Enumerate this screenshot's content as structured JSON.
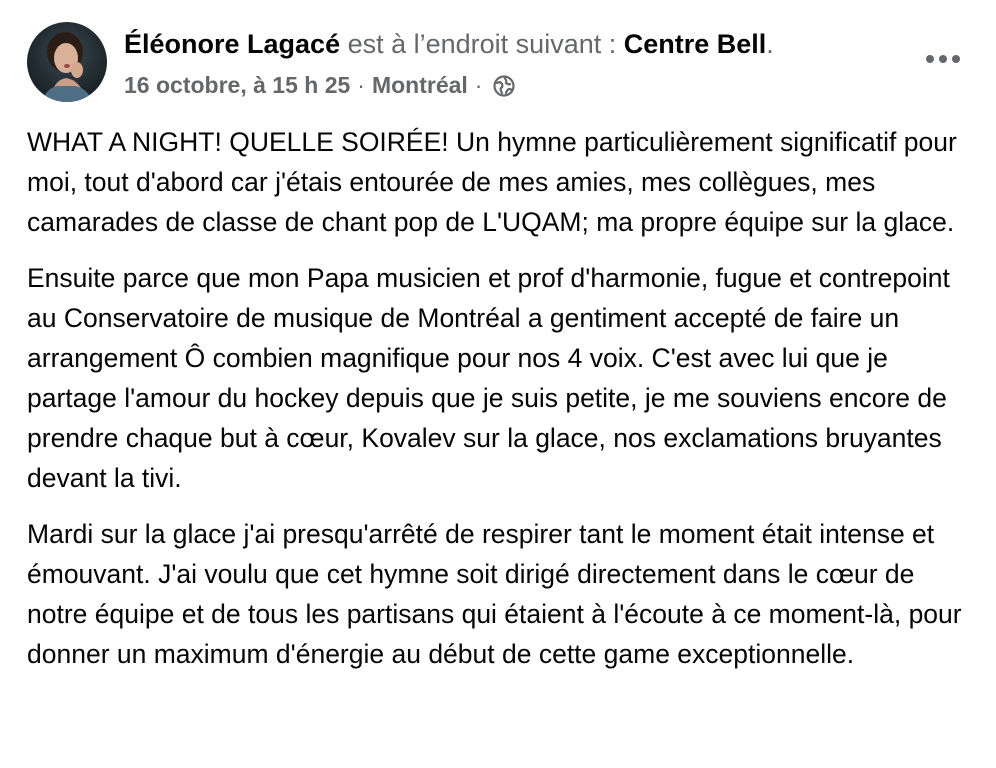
{
  "post": {
    "author": "Éléonore Lagacé",
    "checkin_text": " est à l’endroit suivant : ",
    "place": "Centre Bell",
    "place_suffix": ".",
    "timestamp": "16 octobre, à 15 h 25",
    "separator": "·",
    "location": "Montréal",
    "privacy_icon": "globe-icon",
    "more_icon": "more-options-icon",
    "paragraphs": [
      "WHAT A NIGHT! QUELLE SOIRÉE! Un hymne particulièrement significatif pour moi, tout d'abord car j'étais entourée de mes amies, mes collègues, mes camarades de classe de chant pop de L'UQAM; ma propre équipe sur la glace.",
      "Ensuite parce que mon Papa musicien et prof d'harmonie, fugue et contrepoint au Conservatoire de musique de Montréal a gentiment accepté de faire un arrangement Ô combien magnifique pour nos 4 voix. C'est avec lui que je partage l'amour du hockey depuis que je suis petite, je me souviens encore de prendre chaque but à cœur, Kovalev sur la glace, nos exclamations bruyantes devant la tivi.",
      "Mardi sur la glace j'ai presqu'arrêté de respirer tant le moment était intense et émouvant. J'ai voulu que cet hymne soit dirigé directement dans le cœur de notre équipe et de tous les partisans qui étaient à l'écoute à ce moment-là, pour donner un maximum d'énergie au début de cette game exceptionnelle."
    ]
  },
  "colors": {
    "primary_text": "#050505",
    "secondary_text": "#65676b",
    "background": "#ffffff"
  }
}
